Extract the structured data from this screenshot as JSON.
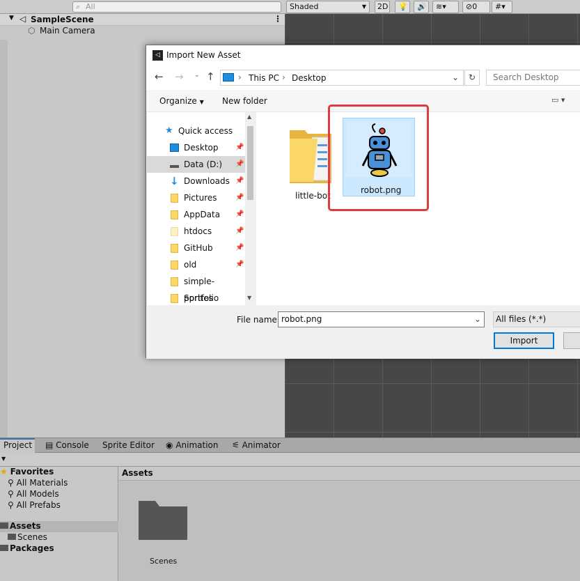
{
  "hierarchy": {
    "search_placeholder": "All",
    "scene_name": "SampleScene",
    "objects": [
      "Main Camera"
    ]
  },
  "scene_toolbar": {
    "shading_mode": "Shaded",
    "mode_2d": "2D",
    "hidden_count": "0"
  },
  "dialog": {
    "title": "Import New Asset",
    "breadcrumb": [
      "This PC",
      "Desktop"
    ],
    "search_placeholder": "Search Desktop",
    "organize_label": "Organize",
    "new_folder_label": "New folder",
    "nav_items": [
      {
        "label": "Quick access",
        "icon": "star-icon",
        "pinned": false
      },
      {
        "label": "Desktop",
        "icon": "desktop-icon",
        "pinned": true
      },
      {
        "label": "Data (D:)",
        "icon": "drive-icon",
        "pinned": true
      },
      {
        "label": "Downloads",
        "icon": "download-icon",
        "pinned": true
      },
      {
        "label": "Pictures",
        "icon": "folder-icon",
        "pinned": true
      },
      {
        "label": "AppData",
        "icon": "folder-icon",
        "pinned": true
      },
      {
        "label": "htdocs",
        "icon": "folder-icon",
        "pinned": true
      },
      {
        "label": "GitHub",
        "icon": "folder-icon",
        "pinned": true
      },
      {
        "label": "old",
        "icon": "folder-icon",
        "pinned": true
      },
      {
        "label": "simple-portfolio",
        "icon": "folder-icon",
        "pinned": false
      },
      {
        "label": "Sprites",
        "icon": "folder-icon",
        "pinned": false
      }
    ],
    "files": [
      {
        "name": "little-bot",
        "type": "folder"
      },
      {
        "name": "robot.png",
        "type": "image"
      }
    ],
    "file_name_label": "File name:",
    "file_name_value": "robot.png",
    "file_type": "All files (*.*)",
    "import_label": "Import"
  },
  "bottom_panel": {
    "tabs": [
      "Project",
      "Console",
      "Sprite Editor",
      "Animation",
      "Animator"
    ],
    "favorites_label": "Favorites",
    "favorites": [
      "All Materials",
      "All Models",
      "All Prefabs"
    ],
    "assets_label": "Assets",
    "asset_folders": [
      "Scenes"
    ],
    "packages_label": "Packages",
    "assets_header": "Assets",
    "grid_items": [
      "Scenes"
    ]
  },
  "colors": {
    "accent": "#0078d7",
    "highlight": "#e03c3c",
    "scene_bg": "#474747"
  }
}
